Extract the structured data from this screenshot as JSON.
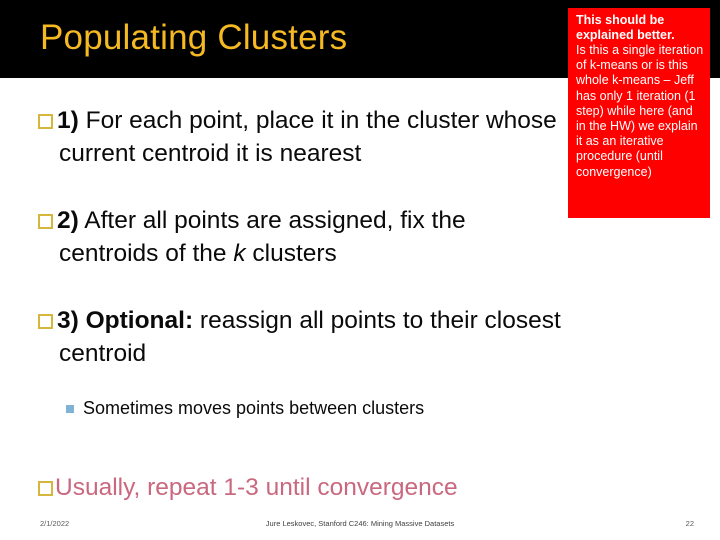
{
  "slide": {
    "title": "Populating Clusters",
    "title_color": "#F5B921",
    "banner_color": "#000000",
    "background": "#ffffff"
  },
  "bullets": [
    {
      "marker": "hollow-square-bullet",
      "lead": "1)",
      "text": " For each point, place it in the cluster whose",
      "continuation": "current centroid it is nearest"
    },
    {
      "marker": "hollow-square-bullet",
      "lead": "2)",
      "text": " After all points are assigned, fix the",
      "continuation_pre": "centroids of the ",
      "continuation_italic": "k",
      "continuation_post": " clusters"
    },
    {
      "marker": "hollow-square-bullet",
      "lead": "3) Optional:",
      "text": " reassign all points to their closest",
      "continuation": "centroid"
    }
  ],
  "sub_bullet": {
    "marker": "small-square-bullet",
    "marker_color": "#7FB2D4",
    "text": "Sometimes moves points between clusters"
  },
  "final_line": {
    "marker": "hollow-square-bullet",
    "text": "Usually, repeat 1-3 until convergence",
    "color": "#C9687E"
  },
  "annotation": {
    "background": "#FF0000",
    "text_color": "#FFFFFF",
    "heading": "This should be explained better.",
    "body": "Is this a single iteration of k-means or is this whole k-means – Jeff has only 1 iteration (1 step) while here (and in the HW) we explain it as an iterative procedure (until convergence)"
  },
  "footer": {
    "date": "2/1/2022",
    "center": "Jure Leskovec, Stanford C246: Mining Massive Datasets",
    "page": "22"
  }
}
